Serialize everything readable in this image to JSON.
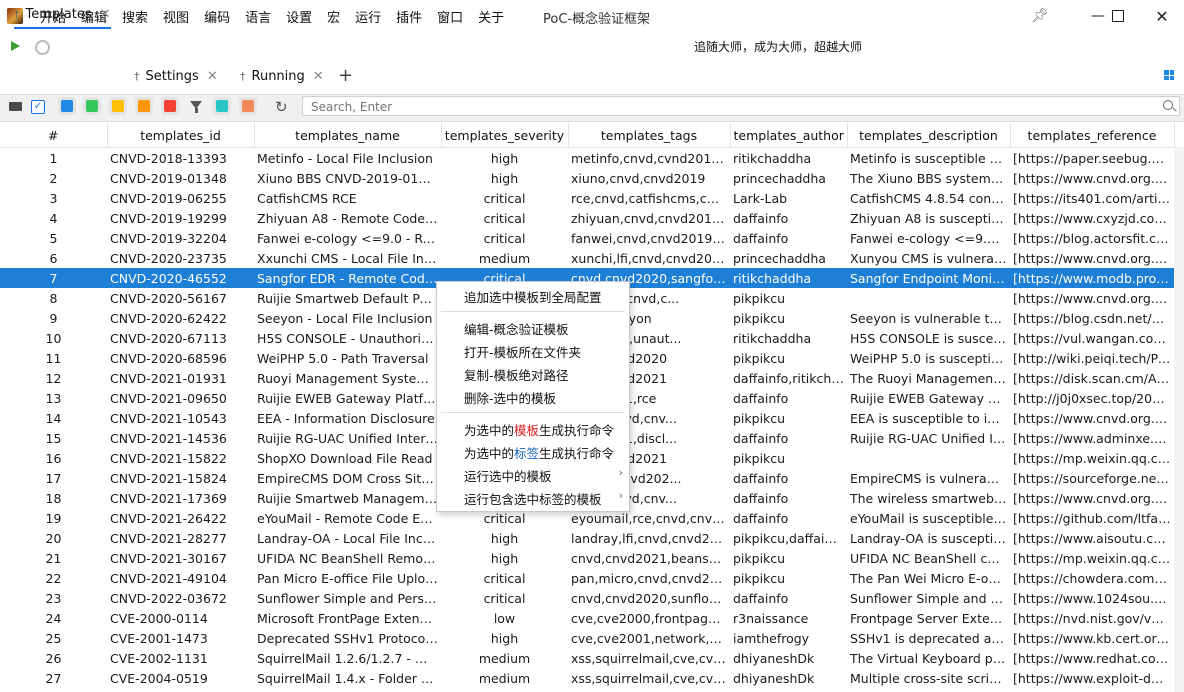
{
  "window": {
    "title": "PoC-概念验证框架",
    "menu": [
      "开始",
      "编辑",
      "搜索",
      "视图",
      "编码",
      "语言",
      "设置",
      "宏",
      "运行",
      "插件",
      "窗口",
      "关于"
    ],
    "slogan": "追随大师，成为大师，超越大师"
  },
  "tabs": [
    {
      "label": "Templates",
      "active": true
    },
    {
      "label": "Settings",
      "active": false
    },
    {
      "label": "Running",
      "active": false
    }
  ],
  "toolbar": {
    "swatch_colors": [
      "#1e88e5",
      "#34c759",
      "#ffc107",
      "#ff9800",
      "#f44336",
      "#26c6c6",
      "#f28a5a"
    ],
    "search_placeholder": "Search, Enter"
  },
  "table": {
    "columns": [
      "#",
      "templates_id",
      "templates_name",
      "templates_severity",
      "templates_tags",
      "templates_author",
      "templates_description",
      "templates_reference"
    ],
    "selected_row": 7,
    "rows": [
      [
        "1",
        "CNVD-2018-13393",
        "Metinfo - Local File Inclusion",
        "high",
        "metinfo,cnvd,cvnd2018,lfi",
        "ritikchaddha",
        "Metinfo is susceptible to ...",
        "[https://paper.seebug.or..."
      ],
      [
        "2",
        "CNVD-2019-01348",
        "Xiuno BBS CNVD-2019-01348",
        "high",
        "xiuno,cnvd,cnvd2019",
        "princechaddha",
        "The Xiuno BBS system ha...",
        "[https://www.cnvd.org.cn..."
      ],
      [
        "3",
        "CNVD-2019-06255",
        "CatfishCMS RCE",
        "critical",
        "rce,cnvd,catfishcms,cnvd...",
        "Lark-Lab",
        "CatfishCMS 4.8.54 contai...",
        "[https://its401.com/articl..."
      ],
      [
        "4",
        "CNVD-2019-19299",
        "Zhiyuan A8 - Remote Code E...",
        "critical",
        "zhiyuan,cnvd,cnvd2019,rce",
        "daffainfo",
        "Zhiyuan A8 is susceptible...",
        "[https://www.cxyzjd.com/..."
      ],
      [
        "5",
        "CNVD-2019-32204",
        "Fanwei e-cology <=9.0 - Rem...",
        "critical",
        "fanwei,cnvd,cnvd2019,rce",
        "daffainfo",
        "Fanwei e-cology <=9.0 is...",
        "[https://blog.actorsfit.co..."
      ],
      [
        "6",
        "CNVD-2020-23735",
        "Xxunchi CMS - Local File Inclu...",
        "medium",
        "xunchi,lfi,cnvd,cnvd2020",
        "princechaddha",
        "Xunyou CMS is vulnerable...",
        "[https://www.cnvd.org.cn..."
      ],
      [
        "7",
        "CNVD-2020-46552",
        "Sangfor EDR - Remote Code ...",
        "critical",
        "cnvd,cnvd2020,sangfor,rce",
        "ritikchaddha",
        "Sangfor Endpoint Monito...",
        "[https://www.modb.pro/..."
      ],
      [
        "8",
        "CNVD-2020-56167",
        "Ruijie Smartweb Default Pass...",
        "",
        "ult-login,cnvd,c...",
        "pikpikcu",
        "",
        "[https://www.cnvd.org.cn..."
      ],
      [
        "9",
        "CNVD-2020-62422",
        "Seeyon - Local File Inclusion",
        "",
        "2020,seeyon",
        "pikpikcu",
        "Seeyon is vulnerable to l...",
        "[https://blog.csdn.net/m0..."
      ],
      [
        "10",
        "CNVD-2020-67113",
        "H5S CONSOLE - Unauthorize...",
        "",
        "2020,h5s,unaut...",
        "ritikchaddha",
        "H5S CONSOLE is suscept...",
        "[https://vul.wangan.com/..."
      ],
      [
        "11",
        "CNVD-2020-68596",
        "WeiPHP 5.0 - Path Traversal",
        "",
        "cnvd,cnvd2020",
        "pikpikcu",
        "WeiPHP 5.0 is susceptible...",
        "[http://wiki.peiqi.tech/Pei..."
      ],
      [
        "12",
        "CNVD-2021-01931",
        "Ruoyi Management System - ...",
        "",
        "cnvd,cnvd2021",
        "daffainfo,ritikcha...",
        "The Ruoyi Management ...",
        "[https://disk.scan.cm/All_..."
      ],
      [
        "13",
        "CNVD-2021-09650",
        "Ruijie EWEB Gateway Platfor...",
        "",
        "cnvd2021,rce",
        "daffainfo",
        "Ruijie EWEB Gateway Plat...",
        "[http://j0j0xsec.top/2021/..."
      ],
      [
        "14",
        "CNVD-2021-10543",
        "EEA - Information Disclosure",
        "",
        "osure,cnvd,cnv...",
        "pikpikcu",
        "EEA is susceptible to info...",
        "[https://www.cnvd.org.cn..."
      ],
      [
        "15",
        "CNVD-2021-14536",
        "Ruijie RG-UAC Unified Interne...",
        "",
        "cnvd2021,discl...",
        "daffainfo",
        "Ruijie RG-UAC Unified Int...",
        "[https://www.adminxe.co..."
      ],
      [
        "16",
        "CNVD-2021-15822",
        "ShopXO Download File Read",
        "",
        "cnvd,cnvd2021",
        "pikpikcu",
        "",
        "[https://mp.weixin.qq.co..."
      ],
      [
        "17",
        "CNVD-2021-15824",
        "EmpireCMS DOM Cross Site-...",
        "",
        "s,cnvd,cnvd202...",
        "daffainfo",
        "EmpireCMS is vulnerable...",
        "[https://sourceforge.net/..."
      ],
      [
        "18",
        "CNVD-2021-17369",
        "Ruijie Smartweb Managemen...",
        "",
        "osure,cnvd,cnv...",
        "daffainfo",
        "The wireless smartweb m...",
        "[https://www.cnvd.org.cn..."
      ],
      [
        "19",
        "CNVD-2021-26422",
        "eYouMail - Remote Code Exe...",
        "critical",
        "eyoumail,rce,cnvd,cnvd20...",
        "daffainfo",
        "eYouMail is susceptible t...",
        "[https://github.com/ltfafe..."
      ],
      [
        "20",
        "CNVD-2021-28277",
        "Landray-OA - Local File Inclus...",
        "high",
        "landray,lfi,cnvd,cnvd2021",
        "pikpikcu,daffainfo",
        "Landray-OA is susceptibl...",
        "[https://www.aisoutu.com..."
      ],
      [
        "21",
        "CNVD-2021-30167",
        "UFIDA NC BeanShell Remote ...",
        "high",
        "cnvd,cnvd2021,beanshell,...",
        "pikpikcu",
        "UFIDA NC BeanShell cont...",
        "[https://mp.weixin.qq.co..."
      ],
      [
        "22",
        "CNVD-2021-49104",
        "Pan Micro E-office File Uploa...",
        "critical",
        "pan,micro,cnvd,cnvd2021",
        "pikpikcu",
        "The Pan Wei Micro E-offi...",
        "[https://chowdera.com/2..."
      ],
      [
        "23",
        "CNVD-2022-03672",
        "Sunflower Simple and Person...",
        "critical",
        "cnvd,cnvd2020,sunflower,...",
        "daffainfo",
        "Sunflower Simple and Pe...",
        "[https://www.1024sou.co..."
      ],
      [
        "24",
        "CVE-2000-0114",
        "Microsoft FrontPage Extensio...",
        "low",
        "cve,cve2000,frontpage,mi...",
        "r3naissance",
        "Frontpage Server Extensi...",
        "[https://nvd.nist.gov/vuln..."
      ],
      [
        "25",
        "CVE-2001-1473",
        "Deprecated SSHv1 Protocol ...",
        "high",
        "cve,cve2001,network,ssh,...",
        "iamthefrogy",
        "SSHv1 is deprecated and...",
        "[https://www.kb.cert.org/..."
      ],
      [
        "26",
        "CVE-2002-1131",
        "SquirrelMail 1.2.6/1.2.7 - Mult...",
        "medium",
        "xss,squirrelmail,cve,cve20...",
        "dhiyaneshDk",
        "The Virtual Keyboard plu...",
        "[https://www.redhat.com/s..."
      ],
      [
        "27",
        "CVE-2004-0519",
        "SquirrelMail 1.4.x - Folder Na...",
        "medium",
        "xss,squirrelmail,cve,cve2004...",
        "dhiyaneshDk",
        "Multiple cross-site scripti...",
        "[https://www.exploit-db.c..."
      ]
    ]
  },
  "context_menu": {
    "add_global": "追加选中模板到全局配置",
    "edit": "编辑-概念验证模板",
    "open_folder": "打开-模板所在文件夹",
    "copy_path": "复制-模板绝对路径",
    "delete": "删除-选中的模板",
    "gen_tpl_pre": "为选中的",
    "gen_tpl_hl": "模板",
    "gen_tpl_post": "生成执行命令",
    "gen_tag_pre": "为选中的",
    "gen_tag_hl": "标签",
    "gen_tag_post": "生成执行命令",
    "run_selected": "运行选中的模板",
    "run_tags": "运行包含选中标签的模板"
  }
}
